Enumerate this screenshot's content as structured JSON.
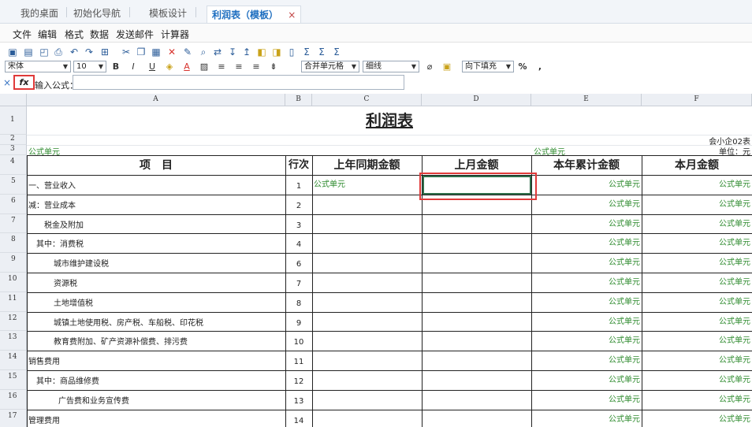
{
  "tabs": [
    {
      "label": "我的桌面"
    },
    {
      "label": "初始化导航"
    },
    {
      "label": "模板设计"
    },
    {
      "label": "利润表（模板）"
    }
  ],
  "tab_close": "×",
  "menu": [
    "文件",
    "编辑",
    "格式",
    "数据",
    "发送邮件",
    "计算器"
  ],
  "toolbar2": {
    "font": "宋体",
    "font_size": "10",
    "merge": "合并单元格",
    "border": "细线",
    "fill": "向下填充",
    "percent": "%",
    "comma": ","
  },
  "formula": {
    "cancel": "×",
    "fx": "fx",
    "label": "输入公式：",
    "value": ""
  },
  "columns": [
    "A",
    "B",
    "C",
    "D",
    "E",
    "F"
  ],
  "sheet": {
    "title": "利润表",
    "form_code": "会小企02表",
    "unit": "单位：元",
    "formula_unit": "公式单元",
    "headers": {
      "item": "项　目",
      "line": "行次",
      "prev_year": "上年同期金额",
      "prev_month": "上月金额",
      "ytd": "本年累计金额",
      "month": "本月金额"
    },
    "rows": [
      {
        "row": "5",
        "item": "一、营业收入",
        "line": "1",
        "c": "公式单元",
        "e": "公式单元",
        "f": "公式单元"
      },
      {
        "row": "6",
        "item": "减：营业成本",
        "line": "2",
        "c": "",
        "e": "公式单元",
        "f": "公式单元"
      },
      {
        "row": "7",
        "item": "税金及附加",
        "line": "3",
        "c": "",
        "e": "公式单元",
        "f": "公式单元"
      },
      {
        "row": "8",
        "item": "其中：消费税",
        "line": "4",
        "c": "",
        "e": "公式单元",
        "f": "公式单元"
      },
      {
        "row": "9",
        "item": "城市维护建设税",
        "line": "6",
        "c": "",
        "e": "公式单元",
        "f": "公式单元"
      },
      {
        "row": "10",
        "item": "资源税",
        "line": "7",
        "c": "",
        "e": "公式单元",
        "f": "公式单元"
      },
      {
        "row": "11",
        "item": "土地增值税",
        "line": "8",
        "c": "",
        "e": "公式单元",
        "f": "公式单元"
      },
      {
        "row": "12",
        "item": "城镇土地使用税、房产税、车船税、印花税",
        "line": "9",
        "c": "",
        "e": "公式单元",
        "f": "公式单元"
      },
      {
        "row": "13",
        "item": "教育费附加、矿产资源补偿费、排污费",
        "line": "10",
        "c": "",
        "e": "公式单元",
        "f": "公式单元"
      },
      {
        "row": "14",
        "item": "销售费用",
        "line": "11",
        "c": "",
        "e": "公式单元",
        "f": "公式单元"
      },
      {
        "row": "15",
        "item": "其中：商品维修费",
        "line": "12",
        "c": "",
        "e": "公式单元",
        "f": "公式单元"
      },
      {
        "row": "16",
        "item": "广告费和业务宣传费",
        "line": "13",
        "c": "",
        "e": "公式单元",
        "f": "公式单元"
      },
      {
        "row": "17",
        "item": "管理费用",
        "line": "14",
        "c": "",
        "e": "公式单元",
        "f": "公式单元"
      }
    ]
  }
}
